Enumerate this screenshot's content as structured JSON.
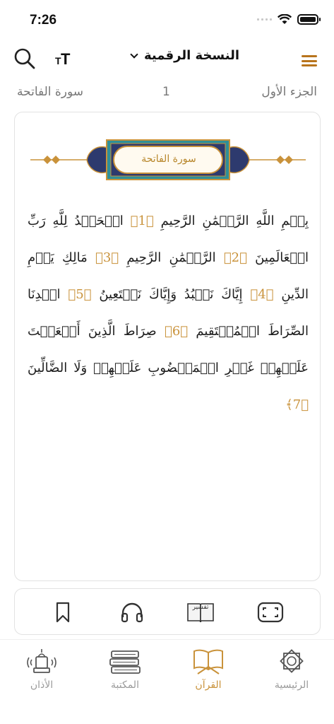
{
  "status_bar": {
    "time": "7:26"
  },
  "header": {
    "title": "النسخة الرقمية",
    "search_icon": "search-icon",
    "font_size_icon": "text-size-icon",
    "menu_icon": "hamburger-menu-icon"
  },
  "info": {
    "juz": "الجزء الأول",
    "page_number": "1",
    "surah": "سورة الفاتحة"
  },
  "page": {
    "surah_banner": "سورة الفاتحة",
    "verses": [
      {
        "text": "بِسۡمِ اللَّهِ الرَّحۡمَٰنِ الرَّحِيمِ",
        "number": "1"
      },
      {
        "text": "الۡحَمۡدُ لِلَّهِ رَبِّ الۡعَالَمِينَ",
        "number": "2"
      },
      {
        "text": "الرَّحۡمَٰنِ الرَّحِيمِ",
        "number": "3"
      },
      {
        "text": "مَالِكِ يَوۡمِ الدِّينِ",
        "number": "4"
      },
      {
        "text": "إِيَّاكَ نَعۡبُدُ وَإِيَّاكَ نَسۡتَعِينُ",
        "number": "5"
      },
      {
        "text": "اهۡدِنَا الصِّرَاطَ الۡمُسۡتَقِيمَ",
        "number": "6"
      },
      {
        "text": "صِرَاطَ الَّذِينَ أَنۡعَمۡتَ عَلَيۡهِمۡ غَيۡرِ الۡمَغۡضُوبِ عَلَيۡهِمۡ وَلَا الضَّالِّينَ",
        "number": "7"
      }
    ]
  },
  "actions": {
    "tafsir_label": "تفسير",
    "icons": [
      "fullscreen-icon",
      "tafsir-book-icon",
      "headphones-icon",
      "bookmark-icon"
    ]
  },
  "tabs": [
    {
      "label": "الرئيسية",
      "icon": "home-star-icon",
      "active": false
    },
    {
      "label": "القرآن",
      "icon": "quran-book-icon",
      "active": true
    },
    {
      "label": "المكتبة",
      "icon": "library-books-icon",
      "active": false
    },
    {
      "label": "الأذان",
      "icon": "adhan-speaker-icon",
      "active": false
    }
  ],
  "colors": {
    "accent": "#c9923a",
    "menu": "#b8741c",
    "muted": "#9a9a9a"
  }
}
